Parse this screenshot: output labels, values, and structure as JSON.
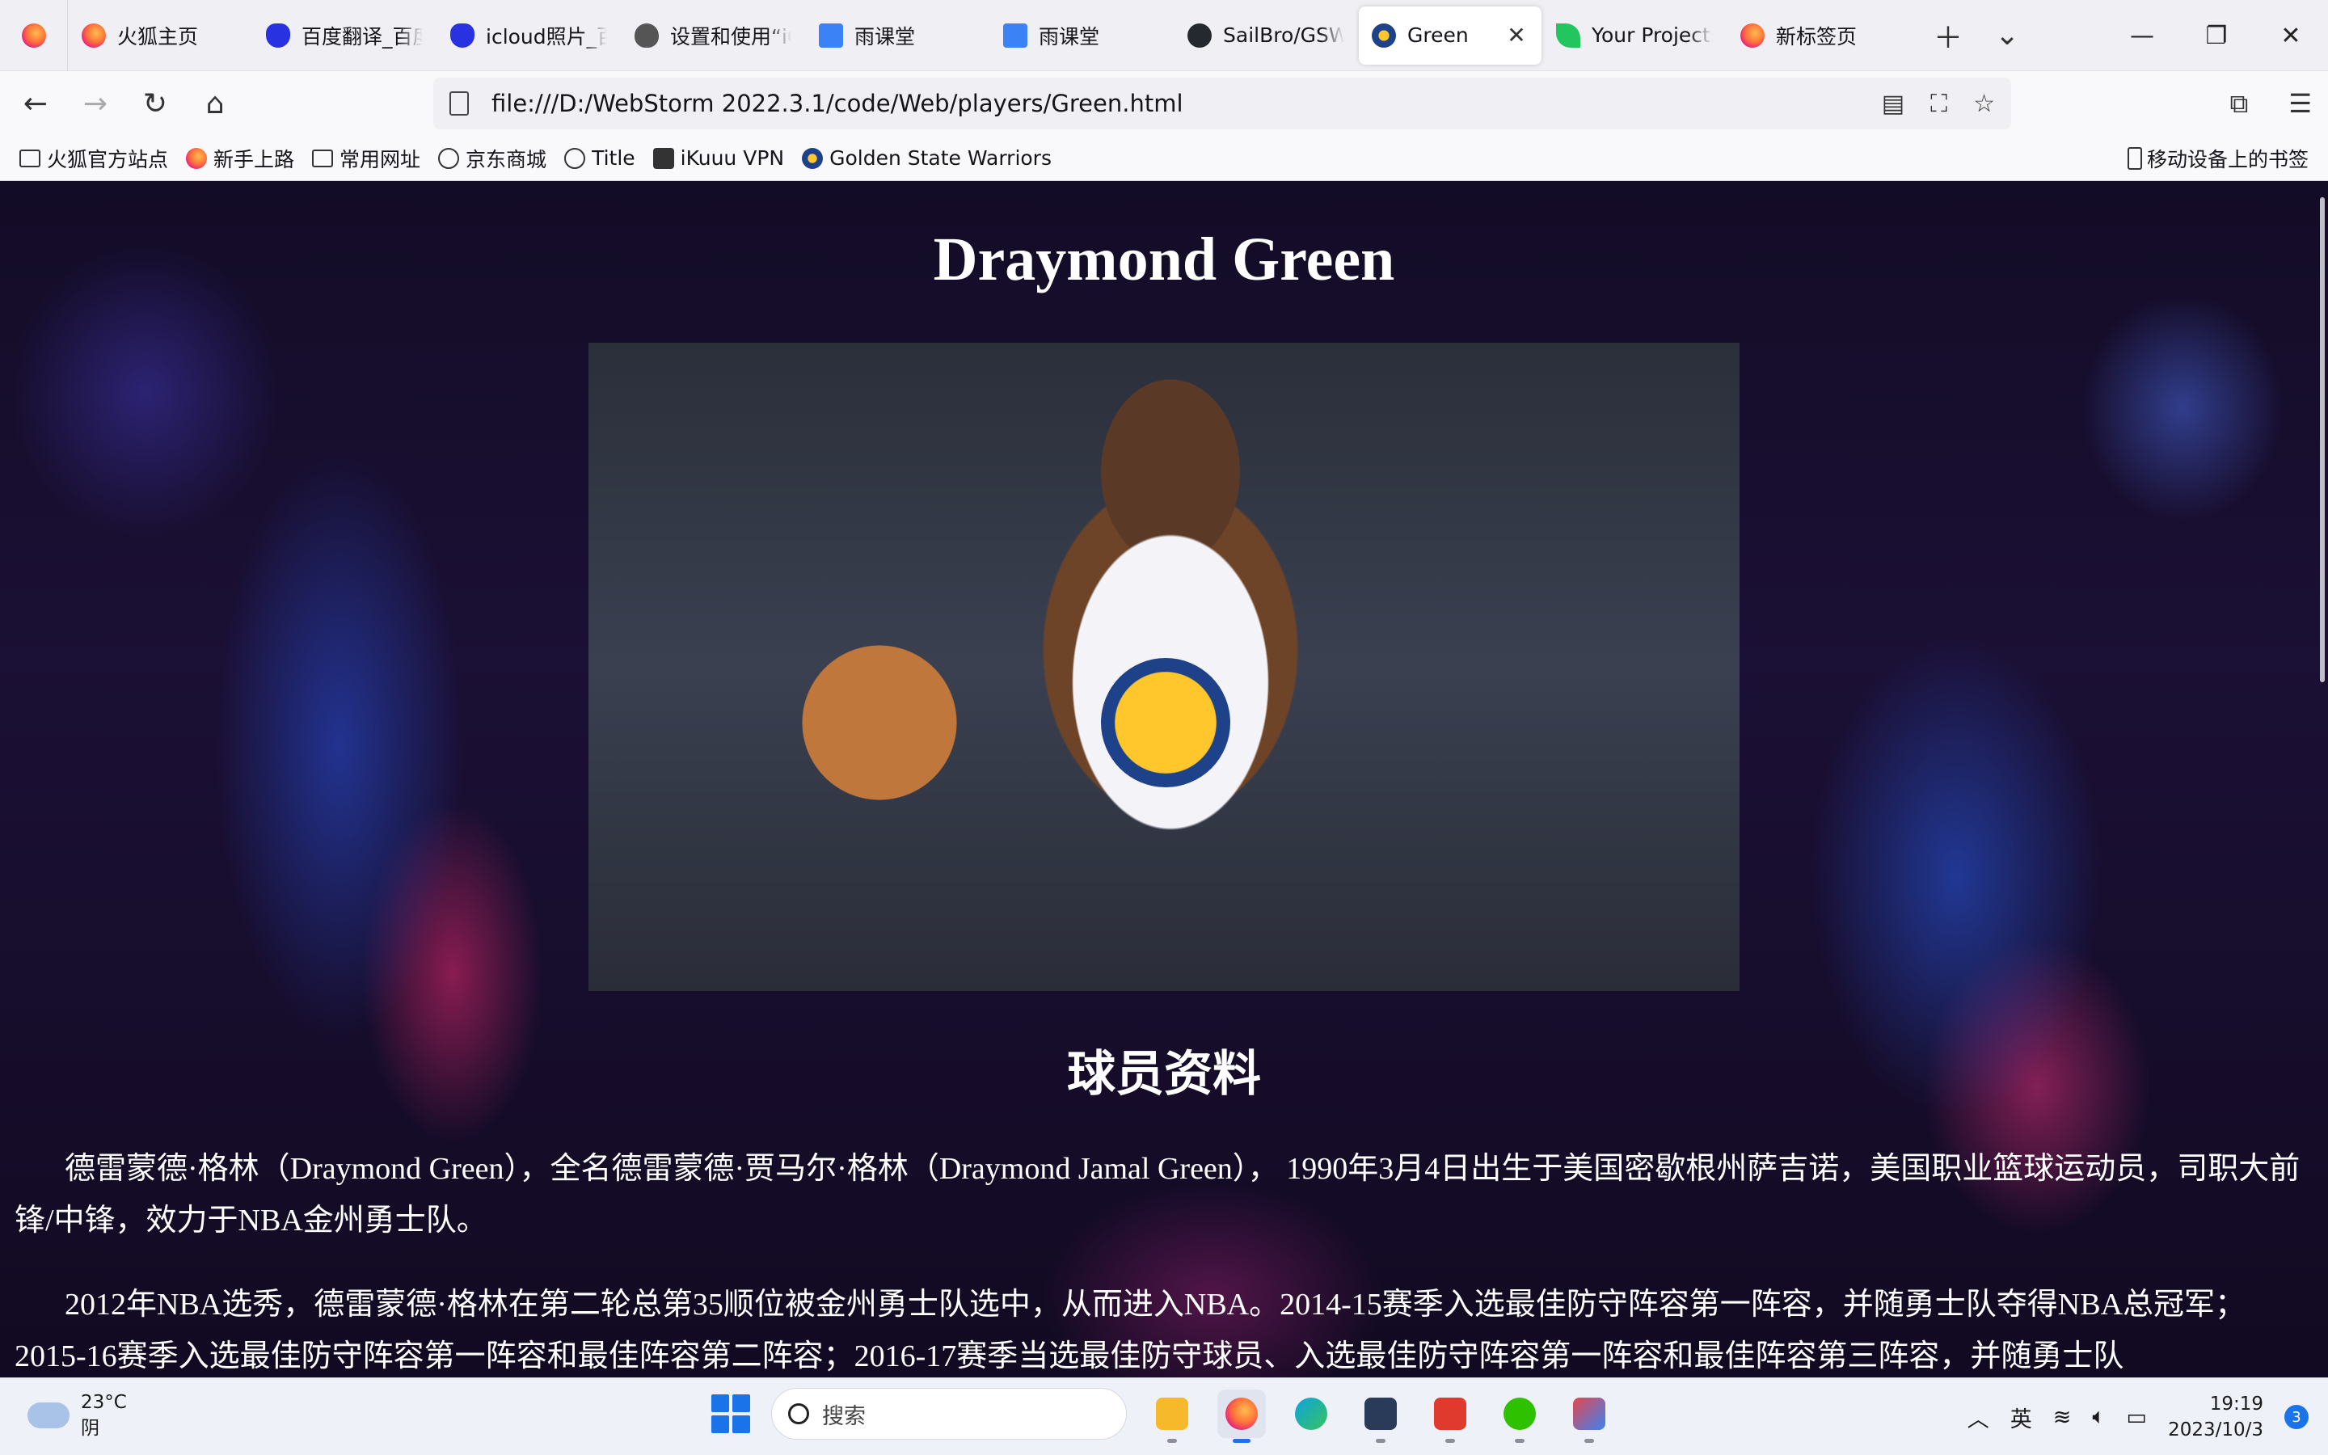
{
  "tabs": [
    {
      "label": "火狐主页",
      "icon": "firefox-icon"
    },
    {
      "label": "百度翻译_百度",
      "icon": "baidu-icon"
    },
    {
      "label": "icloud照片_百度",
      "icon": "baidu-icon"
    },
    {
      "label": "设置和使用“iCloud",
      "icon": "apple-icon"
    },
    {
      "label": "雨课堂",
      "icon": "rain-classroom-icon"
    },
    {
      "label": "雨课堂",
      "icon": "rain-classroom-icon"
    },
    {
      "label": "SailBro/GSW",
      "icon": "github-icon"
    },
    {
      "label": "Green",
      "icon": "warriors-icon",
      "active": true
    },
    {
      "label": "Your Projects",
      "icon": "leaf-icon"
    },
    {
      "label": "新标签页",
      "icon": "firefox-icon"
    }
  ],
  "url": "file:///D:/WebStorm 2022.3.1/code/Web/players/Green.html",
  "bookmarks": [
    {
      "label": "火狐官方站点",
      "icon": "folder-icon"
    },
    {
      "label": "新手上路",
      "icon": "firefox-icon"
    },
    {
      "label": "常用网址",
      "icon": "folder-icon"
    },
    {
      "label": "京东商城",
      "icon": "globe-icon"
    },
    {
      "label": "Title",
      "icon": "globe-icon"
    },
    {
      "label": "iKuuu VPN",
      "icon": "cat-icon"
    },
    {
      "label": "Golden State Warriors",
      "icon": "warriors-icon"
    }
  ],
  "bookmarks_right": "移动设备上的书签",
  "page": {
    "title": "Draymond Green",
    "section_title": "球员资料",
    "paragraph1": "德雷蒙德·格林（Draymond Green），全名德雷蒙德·贾马尔·格林（Draymond Jamal Green）， 1990年3月4日出生于美国密歇根州萨吉诺，美国职业篮球运动员，司职大前锋/中锋，效力于NBA金州勇士队。",
    "paragraph2": "2012年NBA选秀，德雷蒙德·格林在第二轮总第35顺位被金州勇士队选中，从而进入NBA。2014-15赛季入选最佳防守阵容第一阵容，并随勇士队夺得NBA总冠军；2015-16赛季入选最佳防守阵容第一阵容和最佳阵容第二阵容；2016-17赛季当选最佳防守球员、入选最佳防守阵容第一阵容和最佳阵容第三阵容，并随勇士队"
  },
  "taskbar": {
    "temperature": "23°C",
    "weather": "阴",
    "search_placeholder": "搜索",
    "ime": "英",
    "time": "19:19",
    "date": "2023/10/3",
    "notifications": "3"
  }
}
